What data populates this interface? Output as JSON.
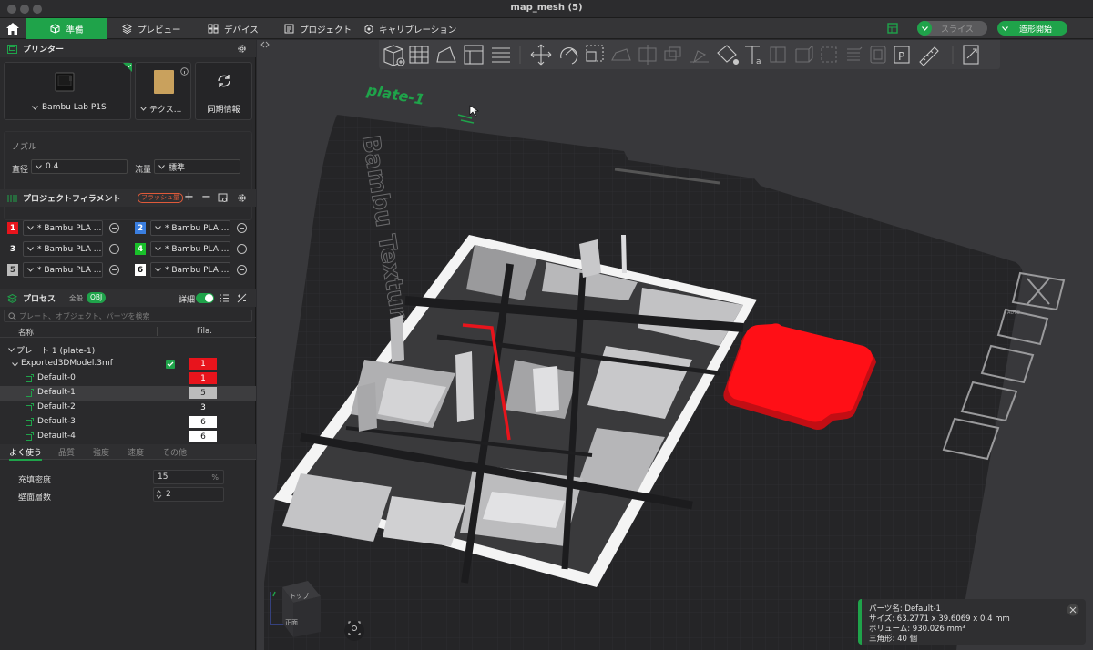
{
  "window": {
    "title": "map_mesh (5)"
  },
  "menu": {
    "tabs": [
      {
        "label": "準備",
        "icon": "cube-icon"
      },
      {
        "label": "プレビュー",
        "icon": "layers-icon"
      },
      {
        "label": "デバイス",
        "icon": "device-icon"
      },
      {
        "label": "プロジェクト",
        "icon": "project-icon"
      },
      {
        "label": "キャリブレーション",
        "icon": "calibration-icon"
      }
    ],
    "slice_label": "スライス",
    "print_label": "造形開始"
  },
  "printer": {
    "section_title": "プリンター",
    "printer_name": "Bambu Lab P1S",
    "plate_name": "テクス...",
    "sync_label": "同期情報",
    "nozzle_title": "ノズル",
    "diameter_label": "直径",
    "diameter_value": "0.4",
    "flow_label": "流量",
    "flow_value": "標準"
  },
  "filament": {
    "section_title": "プロジェクトフィラメント",
    "flush_badge": "フラッシュ量",
    "slots": [
      {
        "num": "1",
        "name": "* Bambu PLA ...",
        "color": "#e8141c",
        "text": "#ffffff"
      },
      {
        "num": "2",
        "name": "* Bambu PLA ...",
        "color": "#3a7ee0",
        "text": "#ffffff"
      },
      {
        "num": "3",
        "name": "* Bambu PLA ...",
        "color": "#2a2a2c",
        "text": "#ffffff"
      },
      {
        "num": "4",
        "name": "* Bambu PLA ...",
        "color": "#19c02a",
        "text": "#ffffff"
      },
      {
        "num": "5",
        "name": "* Bambu PLA ...",
        "color": "#bcbcbc",
        "text": "#333333"
      },
      {
        "num": "6",
        "name": "* Bambu PLA ...",
        "color": "#ffffff",
        "text": "#111111"
      }
    ]
  },
  "process": {
    "section_title": "プロセス",
    "scope_all": "全般",
    "scope_obj": "OBJ",
    "detail_label": "詳細",
    "search_placeholder": "プレート、オブジェクト、パーツを検索",
    "col_name": "名称",
    "col_fila": "Fila.",
    "tree": [
      {
        "label": "プレート 1 (plate-1)",
        "indent": 10,
        "fila": "",
        "fila_color": "",
        "fila_text": ""
      },
      {
        "label": "Exported3DModel.3mf",
        "indent": 14,
        "fila": "1",
        "fila_color": "#e8141c",
        "fila_text": "#ffffff"
      },
      {
        "label": "Default-0",
        "indent": 40,
        "fila": "1",
        "fila_color": "#e8141c",
        "fila_text": "#ffffff"
      },
      {
        "label": "Default-1",
        "indent": 40,
        "fila": "5",
        "fila_color": "#bcbcbc",
        "fila_text": "#222222"
      },
      {
        "label": "Default-2",
        "indent": 40,
        "fila": "3",
        "fila_color": "#2a2a2c",
        "fila_text": "#ffffff"
      },
      {
        "label": "Default-3",
        "indent": 40,
        "fila": "6",
        "fila_color": "#ffffff",
        "fila_text": "#111111"
      },
      {
        "label": "Default-4",
        "indent": 40,
        "fila": "6",
        "fila_color": "#ffffff",
        "fila_text": "#111111"
      }
    ],
    "subtabs": [
      "よく使う",
      "品質",
      "強度",
      "速度",
      "その他"
    ],
    "infill_label": "充填密度",
    "infill_value": "15",
    "infill_unit": "%",
    "walls_label": "壁面層数",
    "walls_value": "2"
  },
  "viewport": {
    "plate_label": "plate-1",
    "bed_text": "Bambu Textured P",
    "cube_top": "トップ",
    "cube_front": "正面",
    "part_info": {
      "name": "パーツ名: Default-1",
      "size": "サイズ: 63.2771 x 39.6069 x 0.4 mm",
      "volume": "ボリューム: 930.026 mm³",
      "triangles": "三角形: 40 個"
    }
  },
  "colors": {
    "accent": "#1fa34a",
    "red": "#e8141c"
  }
}
